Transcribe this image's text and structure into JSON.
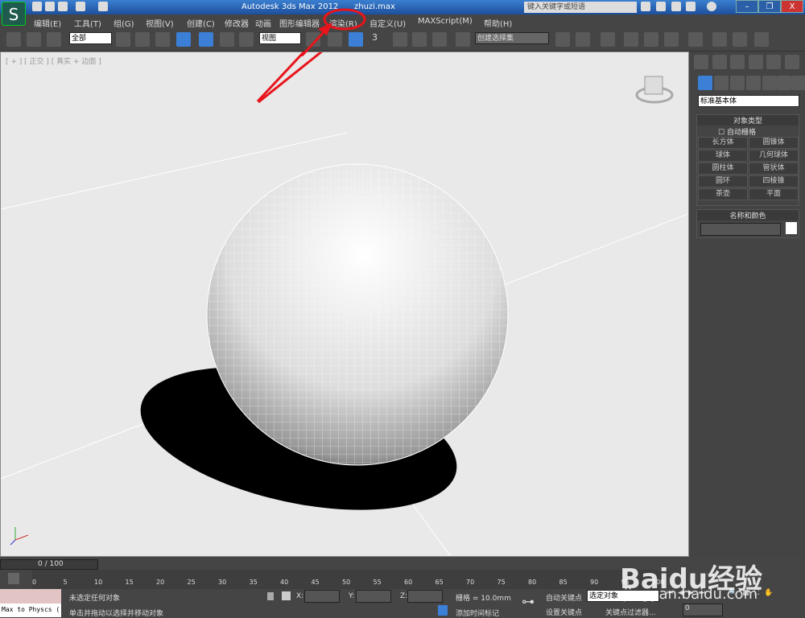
{
  "titlebar": {
    "title": "Autodesk 3ds Max  2012",
    "file": "zhuzi.max",
    "search_placeholder": "键入关键字或短语",
    "logo": "3ds-max-logo"
  },
  "menu": [
    "编辑(E)",
    "工具(T)",
    "组(G)",
    "视图(V)",
    "创建(C)",
    "修改器",
    "动画",
    "图形编辑器",
    "渲染(R)",
    "自定义(U)",
    "MAXScript(M)",
    "帮助(H)"
  ],
  "toolbar": {
    "filter": "全部",
    "refcoord": "视图",
    "named_sel": "创建选择集",
    "snap_num": "3"
  },
  "viewport": {
    "label": "[ + ] [ 正交 ] [ 真实 + 边面 ]"
  },
  "panel": {
    "dropdown": "标准基本体",
    "rollout_object_type": "对象类型",
    "autogrid": "自动栅格",
    "buttons": [
      "长方体",
      "圆锥体",
      "球体",
      "几何球体",
      "圆柱体",
      "管状体",
      "圆环",
      "四棱锥",
      "茶壶",
      "平面"
    ],
    "rollout_name_color": "名称和颜色",
    "object_color": "#ffffff"
  },
  "timeline": {
    "frame": "0 / 100",
    "ticks": [
      "0",
      "5",
      "10",
      "15",
      "20",
      "25",
      "30",
      "35",
      "40",
      "45",
      "50",
      "55",
      "60",
      "65",
      "70",
      "75",
      "80",
      "85",
      "90",
      "95",
      "100"
    ]
  },
  "status": {
    "maxscript": "Max to Physcs (",
    "selection": "未选定任何对象",
    "prompt": "单击并拖动以选择并移动对象",
    "x": "X:",
    "y": "Y:",
    "z": "Z:",
    "grid": "栅格 = 10.0mm",
    "add_time_tag": "添加时间标记",
    "auto_key": "自动关键点",
    "set_key": "设置关键点",
    "key_mode": "选定对象",
    "key_filters": "关键点过滤器...",
    "frame_input": "0"
  },
  "watermark": {
    "brand": "Baidu经验",
    "url": "jingyan.baidu.com"
  },
  "annotation_color": "#e8141b"
}
